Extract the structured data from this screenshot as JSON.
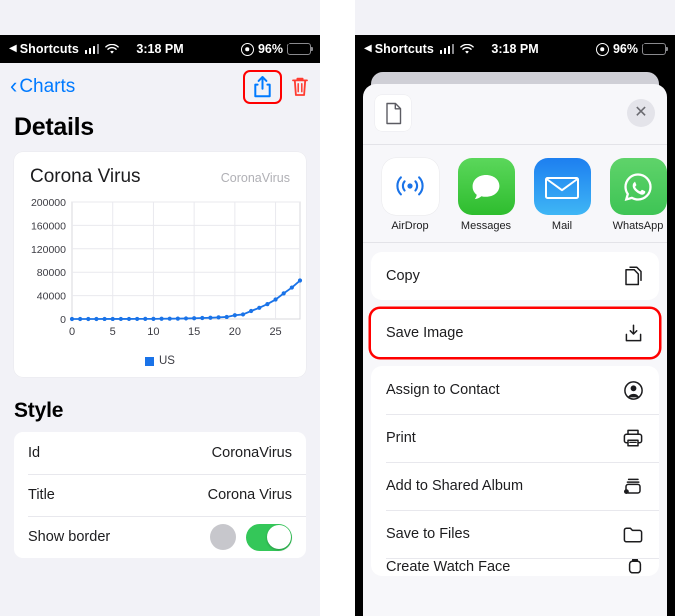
{
  "status_bar": {
    "back_glyph": "◀",
    "app_name": "Shortcuts",
    "time": "3:18 PM",
    "battery_percent": "96%",
    "signal_icon": "cellular-bars-icon",
    "wifi_icon": "wifi-icon",
    "location_icon": "location-services-icon",
    "battery_icon": "battery-charging-icon"
  },
  "left_phone": {
    "nav": {
      "back_label": "Charts",
      "back_chevron": "‹",
      "share_icon": "share-icon",
      "trash_icon": "trash-icon",
      "share_highlight_color": "#ff0000",
      "trash_color": "#ff3b30",
      "share_color": "#007aff"
    },
    "page_title": "Details",
    "chart_card": {
      "title": "Corona Virus",
      "subtitle": "CoronaVirus",
      "legend_label": "US",
      "series_color": "#1a73e8"
    },
    "style_section": {
      "heading": "Style",
      "rows": [
        {
          "label": "Id",
          "value": "CoronaVirus",
          "type": "value"
        },
        {
          "label": "Title",
          "value": "Corona Virus",
          "type": "value"
        },
        {
          "label": "Show border",
          "value": "on",
          "type": "toggle"
        }
      ],
      "toggle_on_color": "#34c759",
      "dot_color": "#c7c7cc"
    }
  },
  "right_phone": {
    "sheet": {
      "doc_icon": "document-icon",
      "close_icon": "close-icon",
      "apps": [
        {
          "label": "AirDrop",
          "icon": "airdrop-icon"
        },
        {
          "label": "Messages",
          "icon": "messages-icon"
        },
        {
          "label": "Mail",
          "icon": "mail-icon"
        },
        {
          "label": "WhatsApp",
          "icon": "whatsapp-icon"
        }
      ],
      "actions_group_1": [
        {
          "label": "Copy",
          "icon": "copy-icon",
          "highlighted": false
        }
      ],
      "actions_group_2": [
        {
          "label": "Save Image",
          "icon": "save-image-icon",
          "highlighted": true
        }
      ],
      "actions_group_3": [
        {
          "label": "Assign to Contact",
          "icon": "contact-icon",
          "highlighted": false
        },
        {
          "label": "Print",
          "icon": "printer-icon",
          "highlighted": false
        },
        {
          "label": "Add to Shared Album",
          "icon": "shared-album-icon",
          "highlighted": false
        },
        {
          "label": "Save to Files",
          "icon": "folder-icon",
          "highlighted": false
        },
        {
          "label": "Create Watch Face",
          "icon": "watch-icon",
          "highlighted": false
        }
      ],
      "highlight_color": "#ff0000"
    }
  },
  "chart_data": {
    "type": "line",
    "title": "Corona Virus",
    "subtitle": "CoronaVirus",
    "xlabel": "",
    "ylabel": "",
    "xlim": [
      0,
      28
    ],
    "ylim": [
      0,
      200000
    ],
    "xticks": [
      0,
      5,
      10,
      15,
      20,
      25
    ],
    "yticks": [
      0,
      40000,
      80000,
      120000,
      160000,
      200000
    ],
    "grid": true,
    "legend": [
      "US"
    ],
    "legend_position": "bottom",
    "markers": true,
    "series": [
      {
        "name": "US",
        "color": "#1a73e8",
        "x": [
          0,
          1,
          2,
          3,
          4,
          5,
          6,
          7,
          8,
          9,
          10,
          11,
          12,
          13,
          14,
          15,
          16,
          17,
          18,
          19,
          20,
          21,
          22,
          23,
          24,
          25,
          26,
          27,
          28
        ],
        "values": [
          15,
          15,
          35,
          53,
          68,
          74,
          98,
          118,
          149,
          217,
          262,
          402,
          518,
          583,
          959,
          1281,
          1663,
          2179,
          2727,
          3499,
          6421,
          7783,
          13677,
          19100,
          25489,
          33276,
          43847,
          53740,
          65778
        ]
      }
    ]
  }
}
